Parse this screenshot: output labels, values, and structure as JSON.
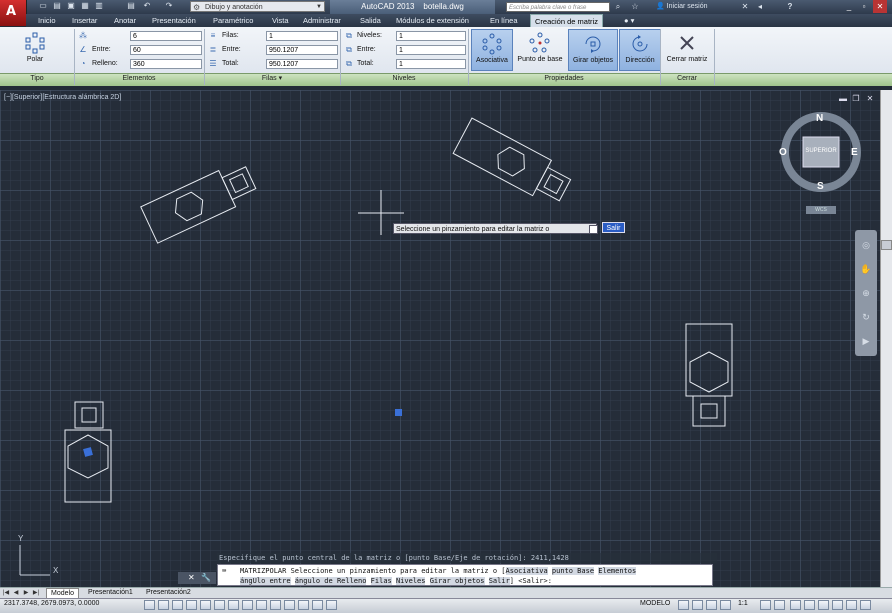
{
  "title_bar": {
    "workspace": "Dibujo y anotación",
    "app_title": "AutoCAD 2013",
    "file_name": "botella.dwg",
    "search_placeholder": "Escriba palabra clave o frase",
    "login_label": "Iniciar sesión",
    "help_label": "?"
  },
  "menu": {
    "items": [
      "Inicio",
      "Insertar",
      "Anotar",
      "Presentación",
      "Paramétrico",
      "Vista",
      "Administrar",
      "Salida",
      "Módulos de extensión",
      "En línea",
      "Creación de matriz"
    ]
  },
  "ribbon": {
    "tipo": {
      "button_label": "Polar",
      "panel_label": "Tipo"
    },
    "elementos": {
      "panel_label": "Elementos",
      "count_value": "6",
      "between_label": "Entre:",
      "between_value": "60",
      "fill_label": "Relleno:",
      "fill_value": "360"
    },
    "filas": {
      "panel_label": "Filas",
      "rows_label": "Filas:",
      "rows_value": "1",
      "between_label": "Entre:",
      "between_value": "950.1207",
      "total_label": "Total:",
      "total_value": "950.1207"
    },
    "niveles": {
      "panel_label": "Niveles",
      "levels_label": "Niveles:",
      "levels_value": "1",
      "between_label": "Entre:",
      "between_value": "1",
      "total_label": "Total:",
      "total_value": "1"
    },
    "propiedades": {
      "panel_label": "Propiedades",
      "associative": "Asociativa",
      "base_point": "Punto de base",
      "rotate_items": "Girar objetos",
      "direction": "Dirección"
    },
    "cerrar": {
      "panel_label": "Cerrar",
      "close_label": "Cerrar matriz"
    }
  },
  "viewport": {
    "label": "[−][Superior][Estructura alámbrica 2D]",
    "tooltip": "Seleccione un pinzamiento para editar la matriz o",
    "tooltip_option": "Salir",
    "viewcube": {
      "n": "N",
      "s": "S",
      "e": "E",
      "o": "O",
      "face": "SUPERIOR",
      "wcs": "WCS"
    },
    "ucs_y": "Y",
    "ucs_x": "X"
  },
  "command": {
    "history": "Especifique el punto central de la matriz o [punto Base/Eje de rotación]: 2411,1428",
    "prefix": "MATRIZPOLAR Seleccione un pinzamiento para editar la matriz o [",
    "options": [
      "Asociativa",
      "punto Base",
      "Elementos",
      "ángUlo entre",
      "ángulo de Relleno",
      "Filas",
      "Niveles",
      "Girar objetos",
      "Salir"
    ],
    "suffix": "] <Salir>:"
  },
  "tabs": {
    "items": [
      "Modelo",
      "Presentación1",
      "Presentación2"
    ]
  },
  "status": {
    "coords": "2317.3748, 2679.0973, 0.0000",
    "space": "MODELO",
    "scale": "1:1"
  }
}
